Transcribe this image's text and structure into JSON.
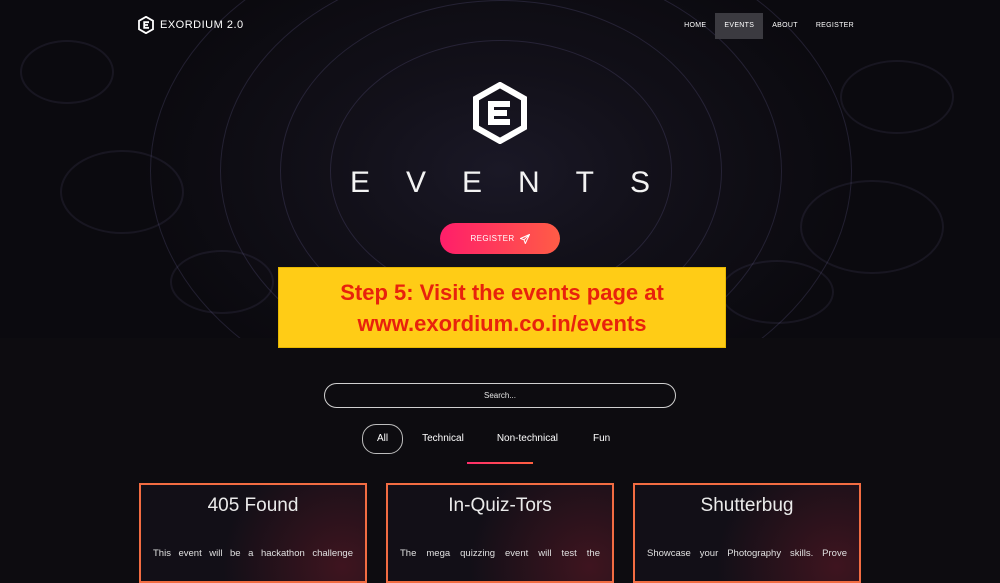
{
  "brand": {
    "name": "EXORDIUM 2.0"
  },
  "nav": {
    "items": [
      "HOME",
      "EVENTS",
      "ABOUT",
      "REGISTER"
    ],
    "active": "EVENTS"
  },
  "hero": {
    "title": "EVENTS",
    "register_label": "REGISTER"
  },
  "overlay": {
    "line1": "Step 5: Visit the events page at",
    "line2": "www.exordium.co.in/events"
  },
  "search": {
    "placeholder": "Search..."
  },
  "filters": [
    "All",
    "Technical",
    "Non-technical",
    "Fun"
  ],
  "cards": [
    {
      "title": "405 Found",
      "desc": "This event will be a hackathon challenge"
    },
    {
      "title": "In-Quiz-Tors",
      "desc": "The mega quizzing event will test the"
    },
    {
      "title": "Shutterbug",
      "desc": "Showcase your Photography skills. Prove"
    }
  ],
  "colors": {
    "accent_gradient_start": "#ff1e6a",
    "accent_gradient_end": "#ff5c46",
    "card_border": "#f26c42",
    "overlay_bg": "#ffcc16",
    "overlay_text": "#e8220c",
    "background": "#0d0c10"
  },
  "icons": {
    "brand": "hexagon-e-logo-icon",
    "register": "paper-plane-icon"
  }
}
